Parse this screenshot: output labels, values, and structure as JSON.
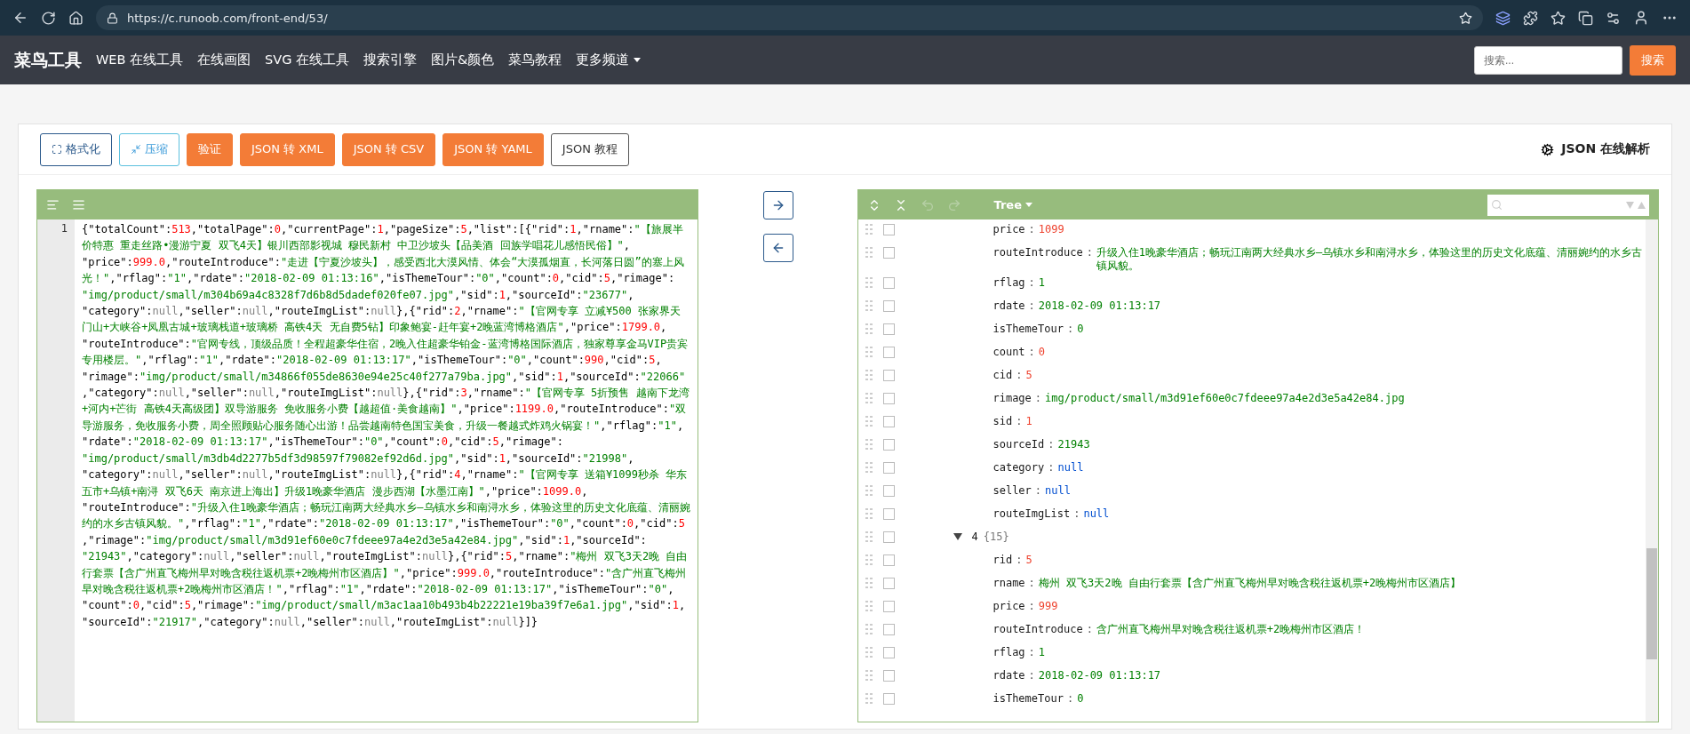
{
  "browser": {
    "url": "https://c.runoob.com/front-end/53/"
  },
  "nav": {
    "logo": "菜鸟工具",
    "links": [
      "WEB 在线工具",
      "在线画图",
      "SVG 在线工具",
      "搜索引擎",
      "图片&颜色",
      "菜鸟教程"
    ],
    "more": "更多频道",
    "search": {
      "placeholder": "搜索..."
    },
    "search_button": "搜索"
  },
  "toolbar": {
    "buttons": [
      {
        "label": "格式化",
        "kind": "format"
      },
      {
        "label": "压缩",
        "kind": "compress"
      },
      {
        "label": "验证",
        "kind": "action"
      },
      {
        "label": "JSON 转 XML",
        "kind": "action"
      },
      {
        "label": "JSON 转 CSV",
        "kind": "action"
      },
      {
        "label": "JSON 转 YAML",
        "kind": "action"
      },
      {
        "label": "JSON 教程",
        "kind": "tutorial"
      }
    ],
    "title": "JSON 在线解析"
  },
  "editor": {
    "line_number": "1",
    "code": "{\"totalCount\":513,\"totalPage\":0,\"currentPage\":1,\"pageSize\":5,\"list\":[{\"rid\":1,\"rname\":\"【旅展半价特惠 重走丝路•漫游宁夏 双飞4天】银川西部影视城 穆民新村 中卫沙坡头【品美酒 回族学唱花儿感悟民俗】\",\"price\":999.0,\"routeIntroduce\":\"走进【宁夏沙坡头】，感受西北大漠风情、体会“大漠孤烟直，长河落日圆”的塞上风光！\",\"rflag\":\"1\",\"rdate\":\"2018-02-09 01:13:16\",\"isThemeTour\":\"0\",\"count\":0,\"cid\":5,\"rimage\":\"img/product/small/m304b69a4c8328f7d6b8d5dadef020fe07.jpg\",\"sid\":1,\"sourceId\":\"23677\",\"category\":null,\"seller\":null,\"routeImgList\":null},{\"rid\":2,\"rname\":\"【官网专享 立减¥500 张家界天门山+大峡谷+凤凰古城+玻璃栈道+玻璃桥 高铁4天 无自费5钻】印象鲍宴-赶年宴+2晚蓝湾博格酒店\",\"price\":1799.0,\"routeIntroduce\":\"官网专线，顶级品质！全程超豪华住宿，2晚入住超豪华铂金-蓝湾博格国际酒店，独家尊享金马VIP贵宾专用楼层。\",\"rflag\":\"1\",\"rdate\":\"2018-02-09 01:13:17\",\"isThemeTour\":\"0\",\"count\":990,\"cid\":5,\"rimage\":\"img/product/small/m34866f055de8630e94e25c40f277a79ba.jpg\",\"sid\":1,\"sourceId\":\"22066\",\"category\":null,\"seller\":null,\"routeImgList\":null},{\"rid\":3,\"rname\":\"【官网专享 5折预售 越南下龙湾+河内+芒街 高铁4天高级团】双导游服务 免收服务小费【越超值·美食越南】\",\"price\":1199.0,\"routeIntroduce\":\"双导游服务，免收服务小费，周全照顾贴心服务随心出游！品尝越南特色国宝美食，升级一餐越式炸鸡火锅宴！\",\"rflag\":\"1\",\"rdate\":\"2018-02-09 01:13:17\",\"isThemeTour\":\"0\",\"count\":0,\"cid\":5,\"rimage\":\"img/product/small/m3db4d2277b5df3d98597f79082ef92d6d.jpg\",\"sid\":1,\"sourceId\":\"21998\",\"category\":null,\"seller\":null,\"routeImgList\":null},{\"rid\":4,\"rname\":\"【官网专享 送箱¥1099秒杀 华东五市+乌镇+南浔 双飞6天 南京进上海出】升级1晚豪华酒店 漫步西湖【水墨江南】\",\"price\":1099.0,\"routeIntroduce\":\"升级入住1晚豪华酒店；畅玩江南两大经典水乡—乌镇水乡和南浔水乡，体验这里的历史文化底蕴、清丽婉约的水乡古镇风貌。\",\"rflag\":\"1\",\"rdate\":\"2018-02-09 01:13:17\",\"isThemeTour\":\"0\",\"count\":0,\"cid\":5,\"rimage\":\"img/product/small/m3d91ef60e0c7fdeee97a4e2d3e5a42e84.jpg\",\"sid\":1,\"sourceId\":\"21943\",\"category\":null,\"seller\":null,\"routeImgList\":null},{\"rid\":5,\"rname\":\"梅州 双飞3天2晚 自由行套票【含广州直飞梅州早对晚含税往返机票+2晚梅州市区酒店】\",\"price\":999.0,\"routeIntroduce\":\"含广州直飞梅州早对晚含税往返机票+2晚梅州市区酒店！\",\"rflag\":\"1\",\"rdate\":\"2018-02-09 01:13:17\",\"isThemeTour\":\"0\",\"count\":0,\"cid\":5,\"rimage\":\"img/product/small/m3ac1aa10b493b4b22221e19ba39f7e6a1.jpg\",\"sid\":1,\"sourceId\":\"21917\",\"category\":null,\"seller\":null,\"routeImgList\":null}]}"
  },
  "tree": {
    "mode": "Tree",
    "items": [
      {
        "children": [
          {
            "key": "price",
            "separator": ":",
            "value": "1099",
            "kind": "number"
          },
          {
            "key": "routeIntroduce",
            "separator": ":",
            "value": "升级入住1晚豪华酒店；畅玩江南两大经典水乡—乌镇水乡和南浔水乡，体验这里的历史文化底蕴、清丽婉约的水乡古镇风貌。",
            "kind": "string"
          },
          {
            "key": "rflag",
            "separator": ":",
            "value": "1",
            "kind": "string"
          },
          {
            "key": "rdate",
            "separator": ":",
            "value": "2018-02-09 01:13:17",
            "kind": "string"
          },
          {
            "key": "isThemeTour",
            "separator": ":",
            "value": "0",
            "kind": "string"
          },
          {
            "key": "count",
            "separator": ":",
            "value": "0",
            "kind": "number"
          },
          {
            "key": "cid",
            "separator": ":",
            "value": "5",
            "kind": "number"
          },
          {
            "key": "rimage",
            "separator": ":",
            "value": "img/product/small/m3d91ef60e0c7fdeee97a4e2d3e5a42e84.jpg",
            "kind": "string"
          },
          {
            "key": "sid",
            "separator": ":",
            "value": "1",
            "kind": "number"
          },
          {
            "key": "sourceId",
            "separator": ":",
            "value": "21943",
            "kind": "string"
          },
          {
            "key": "category",
            "separator": ":",
            "value": "null",
            "kind": "null"
          },
          {
            "key": "seller",
            "separator": ":",
            "value": "null",
            "kind": "null"
          },
          {
            "key": "routeImgList",
            "separator": ":",
            "value": "null",
            "kind": "null"
          }
        ]
      },
      {
        "key": "4",
        "summary": "{15}",
        "expanded": true,
        "children": [
          {
            "key": "rid",
            "separator": ":",
            "value": "5",
            "kind": "number"
          },
          {
            "key": "rname",
            "separator": ":",
            "value": "梅州 双飞3天2晚 自由行套票【含广州直飞梅州早对晚含税往返机票+2晚梅州市区酒店】",
            "kind": "string"
          },
          {
            "key": "price",
            "separator": ":",
            "value": "999",
            "kind": "number"
          },
          {
            "key": "routeIntroduce",
            "separator": ":",
            "value": "含广州直飞梅州早对晚含税往返机票+2晚梅州市区酒店！",
            "kind": "string"
          },
          {
            "key": "rflag",
            "separator": ":",
            "value": "1",
            "kind": "string"
          },
          {
            "key": "rdate",
            "separator": ":",
            "value": "2018-02-09 01:13:17",
            "kind": "string"
          },
          {
            "key": "isThemeTour",
            "separator": ":",
            "value": "0",
            "kind": "string"
          }
        ]
      }
    ]
  }
}
